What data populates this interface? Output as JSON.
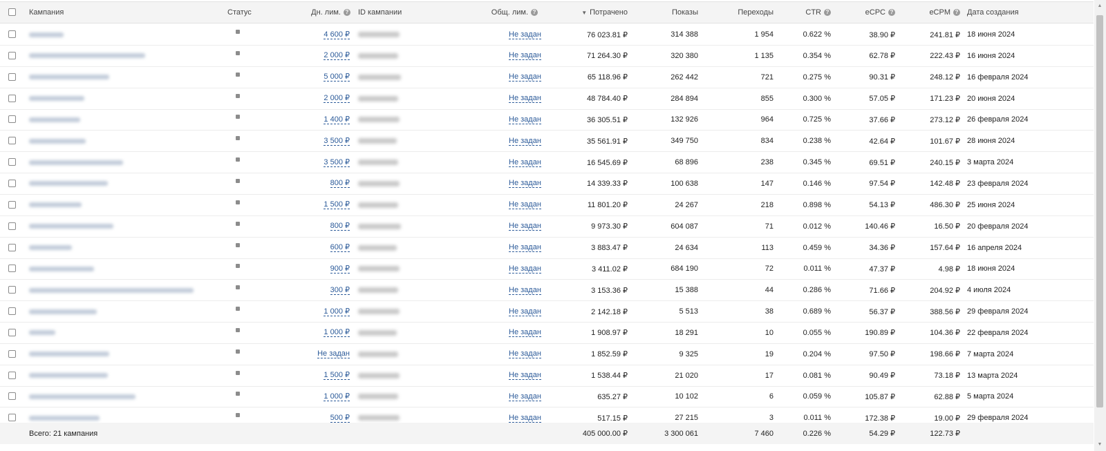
{
  "table": {
    "headers": {
      "campaign": "Кампания",
      "status": "Статус",
      "daily_limit": "Дн. лим.",
      "campaign_id": "ID кампании",
      "total_limit": "Общ. лим.",
      "spent": "Потрачено",
      "impressions": "Показы",
      "clicks": "Переходы",
      "ctr": "CTR",
      "ecpc": "eCPC",
      "ecpm": "eCPM",
      "created": "Дата создания"
    },
    "help_icon": "?",
    "sort_icon": "▼",
    "rows": [
      {
        "daily_limit": "4 600 ₽",
        "total_limit": "Не задан",
        "spent": "76 023.81 ₽",
        "impressions": "314 388",
        "clicks": "1 954",
        "ctr": "0.622 %",
        "ecpc": "38.90 ₽",
        "ecpm": "241.81 ₽",
        "created": "18 июня 2024"
      },
      {
        "daily_limit": "2 000 ₽",
        "total_limit": "Не задан",
        "spent": "71 264.30 ₽",
        "impressions": "320 380",
        "clicks": "1 135",
        "ctr": "0.354 %",
        "ecpc": "62.78 ₽",
        "ecpm": "222.43 ₽",
        "created": "16 июня 2024"
      },
      {
        "daily_limit": "5 000 ₽",
        "total_limit": "Не задан",
        "spent": "65 118.96 ₽",
        "impressions": "262 442",
        "clicks": "721",
        "ctr": "0.275 %",
        "ecpc": "90.31 ₽",
        "ecpm": "248.12 ₽",
        "created": "16 февраля 2024"
      },
      {
        "daily_limit": "2 000 ₽",
        "total_limit": "Не задан",
        "spent": "48 784.40 ₽",
        "impressions": "284 894",
        "clicks": "855",
        "ctr": "0.300 %",
        "ecpc": "57.05 ₽",
        "ecpm": "171.23 ₽",
        "created": "20 июня 2024"
      },
      {
        "daily_limit": "1 400 ₽",
        "total_limit": "Не задан",
        "spent": "36 305.51 ₽",
        "impressions": "132 926",
        "clicks": "964",
        "ctr": "0.725 %",
        "ecpc": "37.66 ₽",
        "ecpm": "273.12 ₽",
        "created": "26 февраля 2024"
      },
      {
        "daily_limit": "3 500 ₽",
        "total_limit": "Не задан",
        "spent": "35 561.91 ₽",
        "impressions": "349 750",
        "clicks": "834",
        "ctr": "0.238 %",
        "ecpc": "42.64 ₽",
        "ecpm": "101.67 ₽",
        "created": "28 июня 2024"
      },
      {
        "daily_limit": "3 500 ₽",
        "total_limit": "Не задан",
        "spent": "16 545.69 ₽",
        "impressions": "68 896",
        "clicks": "238",
        "ctr": "0.345 %",
        "ecpc": "69.51 ₽",
        "ecpm": "240.15 ₽",
        "created": "3 марта 2024"
      },
      {
        "daily_limit": "800 ₽",
        "total_limit": "Не задан",
        "spent": "14 339.33 ₽",
        "impressions": "100 638",
        "clicks": "147",
        "ctr": "0.146 %",
        "ecpc": "97.54 ₽",
        "ecpm": "142.48 ₽",
        "created": "23 февраля 2024"
      },
      {
        "daily_limit": "1 500 ₽",
        "total_limit": "Не задан",
        "spent": "11 801.20 ₽",
        "impressions": "24 267",
        "clicks": "218",
        "ctr": "0.898 %",
        "ecpc": "54.13 ₽",
        "ecpm": "486.30 ₽",
        "created": "25 июня 2024"
      },
      {
        "daily_limit": "800 ₽",
        "total_limit": "Не задан",
        "spent": "9 973.30 ₽",
        "impressions": "604 087",
        "clicks": "71",
        "ctr": "0.012 %",
        "ecpc": "140.46 ₽",
        "ecpm": "16.50 ₽",
        "created": "20 февраля 2024"
      },
      {
        "daily_limit": "600 ₽",
        "total_limit": "Не задан",
        "spent": "3 883.47 ₽",
        "impressions": "24 634",
        "clicks": "113",
        "ctr": "0.459 %",
        "ecpc": "34.36 ₽",
        "ecpm": "157.64 ₽",
        "created": "16 апреля 2024"
      },
      {
        "daily_limit": "900 ₽",
        "total_limit": "Не задан",
        "spent": "3 411.02 ₽",
        "impressions": "684 190",
        "clicks": "72",
        "ctr": "0.011 %",
        "ecpc": "47.37 ₽",
        "ecpm": "4.98 ₽",
        "created": "18 июня 2024"
      },
      {
        "daily_limit": "300 ₽",
        "total_limit": "Не задан",
        "spent": "3 153.36 ₽",
        "impressions": "15 388",
        "clicks": "44",
        "ctr": "0.286 %",
        "ecpc": "71.66 ₽",
        "ecpm": "204.92 ₽",
        "created": "4 июля 2024"
      },
      {
        "daily_limit": "1 000 ₽",
        "total_limit": "Не задан",
        "spent": "2 142.18 ₽",
        "impressions": "5 513",
        "clicks": "38",
        "ctr": "0.689 %",
        "ecpc": "56.37 ₽",
        "ecpm": "388.56 ₽",
        "created": "29 февраля 2024"
      },
      {
        "daily_limit": "1 000 ₽",
        "total_limit": "Не задан",
        "spent": "1 908.97 ₽",
        "impressions": "18 291",
        "clicks": "10",
        "ctr": "0.055 %",
        "ecpc": "190.89 ₽",
        "ecpm": "104.36 ₽",
        "created": "22 февраля 2024"
      },
      {
        "daily_limit": "Не задан",
        "total_limit": "Не задан",
        "spent": "1 852.59 ₽",
        "impressions": "9 325",
        "clicks": "19",
        "ctr": "0.204 %",
        "ecpc": "97.50 ₽",
        "ecpm": "198.66 ₽",
        "created": "7 марта 2024"
      },
      {
        "daily_limit": "1 500 ₽",
        "total_limit": "Не задан",
        "spent": "1 538.44 ₽",
        "impressions": "21 020",
        "clicks": "17",
        "ctr": "0.081 %",
        "ecpc": "90.49 ₽",
        "ecpm": "73.18 ₽",
        "created": "13 марта 2024"
      },
      {
        "daily_limit": "1 000 ₽",
        "total_limit": "Не задан",
        "spent": "635.27 ₽",
        "impressions": "10 102",
        "clicks": "6",
        "ctr": "0.059 %",
        "ecpc": "105.87 ₽",
        "ecpm": "62.88 ₽",
        "created": "5 марта 2024"
      },
      {
        "daily_limit": "500 ₽",
        "total_limit": "Не задан",
        "spent": "517.15 ₽",
        "impressions": "27 215",
        "clicks": "3",
        "ctr": "0.011 %",
        "ecpc": "172.38 ₽",
        "ecpm": "19.00 ₽",
        "created": "29 февраля 2024"
      }
    ],
    "footer": {
      "label": "Всего: 21 кампания",
      "spent": "405 000.00 ₽",
      "impressions": "3 300 061",
      "clicks": "7 460",
      "ctr": "0.226 %",
      "ecpc": "54.29 ₽",
      "ecpm": "122.73 ₽"
    }
  },
  "scrollbar": {
    "up_arrow": "▲",
    "down_arrow": "▼"
  }
}
